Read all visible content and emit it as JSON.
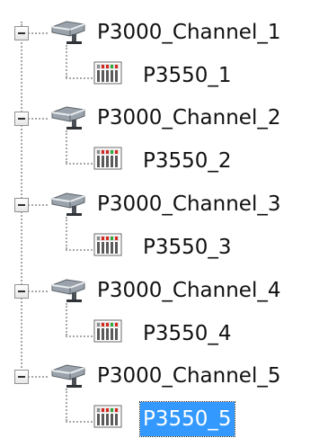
{
  "tree": {
    "channels": [
      {
        "label": "P3000_Channel_1",
        "expanded": true,
        "icon": "network-channel-icon",
        "children": [
          {
            "label": "P3550_1",
            "icon": "io-module-icon",
            "selected": false
          }
        ]
      },
      {
        "label": "P3000_Channel_2",
        "expanded": true,
        "icon": "network-channel-icon",
        "children": [
          {
            "label": "P3550_2",
            "icon": "io-module-icon",
            "selected": false
          }
        ]
      },
      {
        "label": "P3000_Channel_3",
        "expanded": true,
        "icon": "network-channel-icon",
        "children": [
          {
            "label": "P3550_3",
            "icon": "io-module-icon",
            "selected": false
          }
        ]
      },
      {
        "label": "P3000_Channel_4",
        "expanded": true,
        "icon": "network-channel-icon",
        "children": [
          {
            "label": "P3550_4",
            "icon": "io-module-icon",
            "selected": false
          }
        ]
      },
      {
        "label": "P3000_Channel_5",
        "expanded": true,
        "icon": "network-channel-icon",
        "children": [
          {
            "label": "P3550_5",
            "icon": "io-module-icon",
            "selected": true
          }
        ]
      }
    ],
    "selection_color": "#3399ff"
  }
}
